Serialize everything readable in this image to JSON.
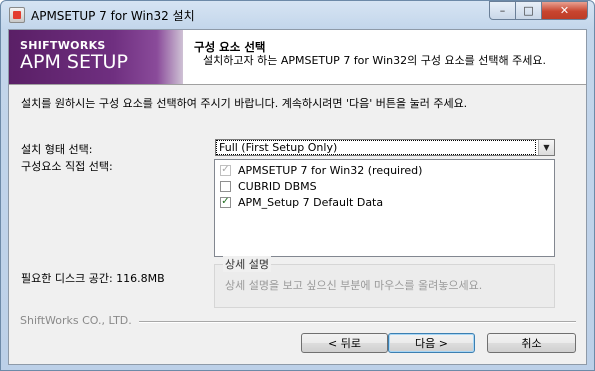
{
  "window": {
    "title": "APMSETUP 7 for Win32 설치",
    "controls": {
      "minimize": "–",
      "maximize": "□",
      "close": "✕"
    }
  },
  "banner": {
    "brand_top": "SHIFTWORKS",
    "brand_main": "APM SETUP",
    "title": "구성 요소 선택",
    "subtitle": "설치하고자 하는 APMSETUP 7 for Win32의 구성 요소를 선택해 주세요."
  },
  "instruction": "설치를 원하시는 구성 요소를 선택하여 주시기 바랍니다. 계속하시려면 '다음' 버튼을 눌러 주세요.",
  "install_type": {
    "label": "설치 형태 선택:",
    "selected": "Full (First Setup Only)"
  },
  "components": {
    "label": "구성요소 직접 선택:",
    "items": [
      {
        "label": "APMSETUP 7 for Win32 (required)",
        "checked": true,
        "disabled": true
      },
      {
        "label": "CUBRID DBMS",
        "checked": false,
        "disabled": false
      },
      {
        "label": "APM_Setup 7 Default Data",
        "checked": true,
        "disabled": false
      }
    ]
  },
  "space": {
    "label": "필요한 디스크 공간: 116.8MB"
  },
  "description": {
    "legend": "상세 설명",
    "text": "상세 설명을 보고 싶으신 부분에 마우스를 올려놓으세요."
  },
  "company": "ShiftWorks CO., LTD.",
  "buttons": {
    "back": "< 뒤로",
    "next": "다음 >",
    "cancel": "취소"
  },
  "colors": {
    "brand_purple": "#6f2f80",
    "client_bg": "#f0f0f0",
    "check_green": "#1f6e1f"
  }
}
